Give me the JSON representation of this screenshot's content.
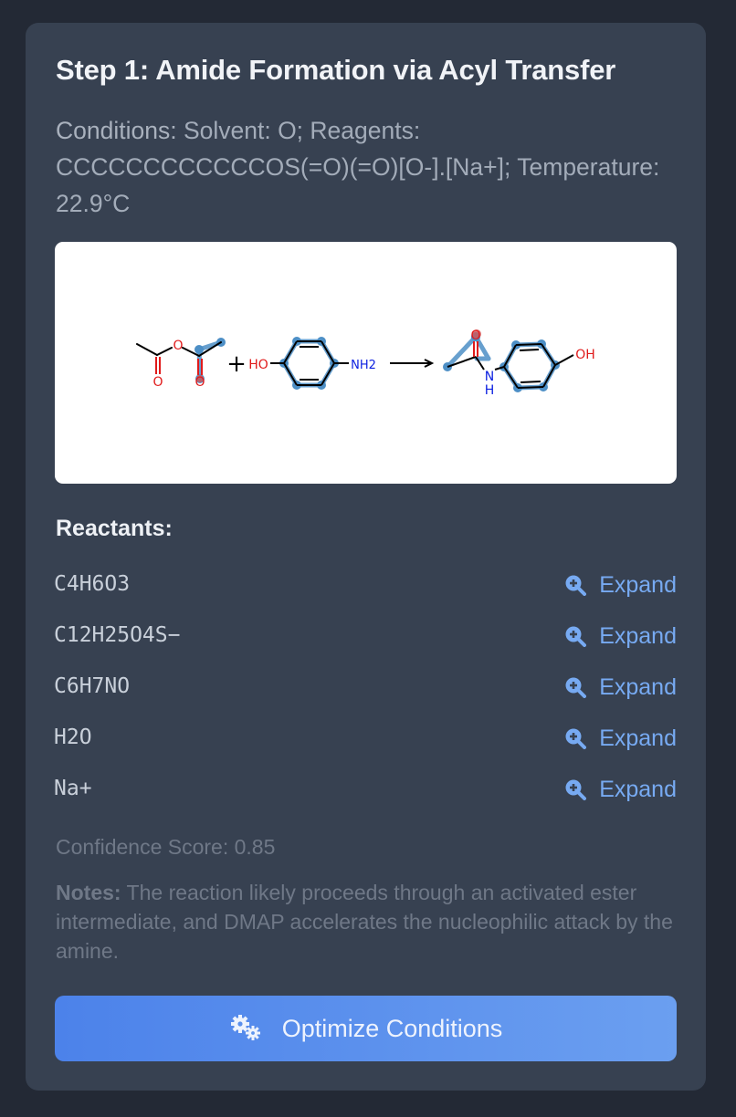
{
  "step": {
    "title": "Step 1: Amide Formation via Acyl Transfer"
  },
  "conditions": {
    "label": "Conditions:",
    "text": "Solvent: O; Reagents: CCCCCCCCCCCCOS(=O)(=O)[O-].[Na+]; Temperature: 22.9°C"
  },
  "scheme": {
    "atom_labels": [
      "O",
      "O",
      "O",
      "HO",
      "NH2",
      "O",
      "N",
      "H",
      "OH"
    ],
    "plus": "+",
    "colors": {
      "bond": "#000000",
      "oxygen": "#e01b1b",
      "nitrogen": "#0a1ee0",
      "highlight": "#4d8fc6",
      "accent_red": "#d45757"
    }
  },
  "reactants": {
    "heading": "Reactants:",
    "expand_label": "Expand",
    "expand_icon": "zoom-in-icon",
    "items": [
      "C4H6O3",
      "C12H25O4S−",
      "C6H7NO",
      "H2O",
      "Na+"
    ]
  },
  "confidence": {
    "text": "Confidence Score: 0.85"
  },
  "notes": {
    "label": "Notes:",
    "text": "The reaction likely proceeds through an activated ester intermediate, and DMAP accelerates the nucleophilic attack by the amine."
  },
  "action": {
    "label": "Optimize Conditions",
    "icon": "gears-icon"
  },
  "colors": {
    "background": "#232935",
    "card": "#374151",
    "accent": "#77aaf2",
    "button_start": "#4c82ea",
    "button_end": "#6b9ff0"
  }
}
